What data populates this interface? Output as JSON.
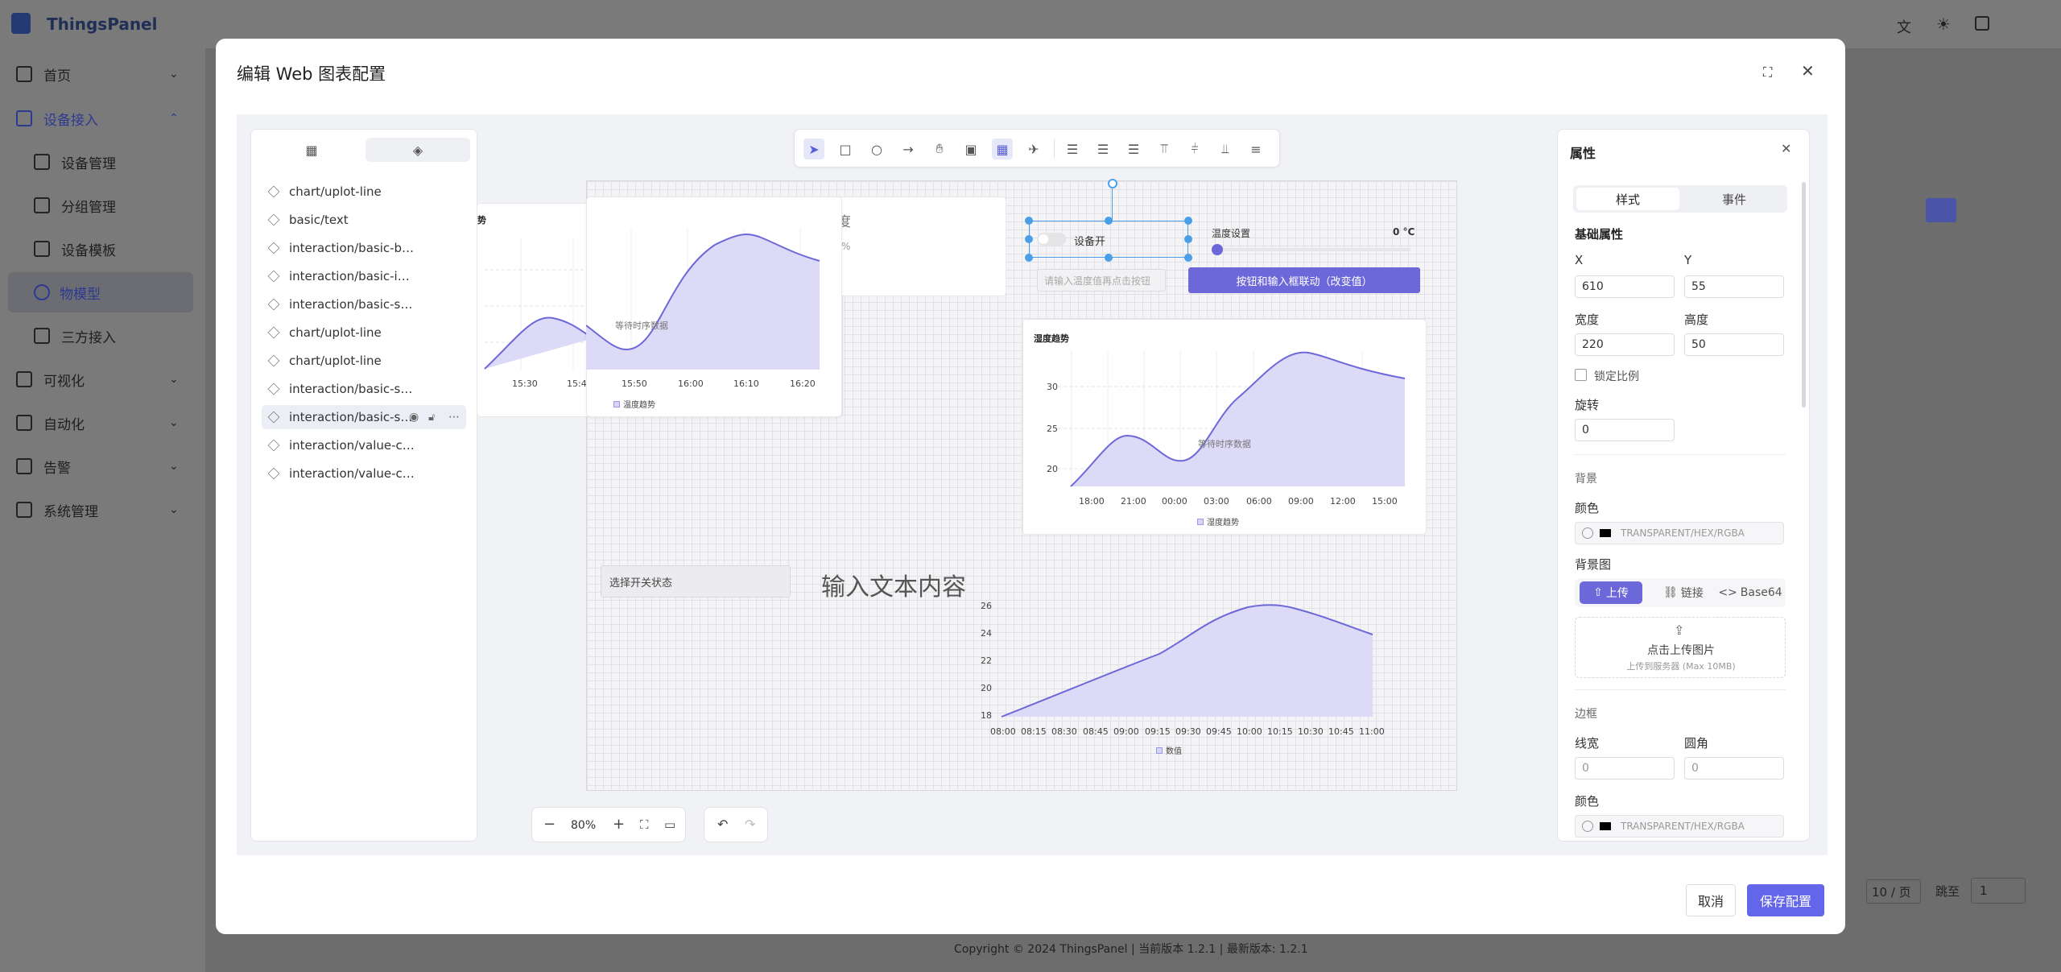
{
  "app": {
    "name": "ThingsPanel",
    "breadcrumb": "物模型",
    "footer": "Copyright © 2024 ThingsPanel | 当前版本 1.2.1 | 最新版本: 1.2.1",
    "page_size": "10 / 页",
    "goto_label": "跳至",
    "goto_value": "1"
  },
  "nav": {
    "items": [
      {
        "label": "首页",
        "icon": "home-icon"
      },
      {
        "label": "设备接入",
        "icon": "device-icon"
      },
      {
        "label": "设备管理",
        "icon": "monitor-icon"
      },
      {
        "label": "分组管理",
        "icon": "grid-icon"
      },
      {
        "label": "设备模板",
        "icon": "template-icon"
      },
      {
        "label": "物模型",
        "icon": "model-icon"
      },
      {
        "label": "三方接入",
        "icon": "link-icon"
      },
      {
        "label": "可视化",
        "icon": "chart-icon"
      },
      {
        "label": "自动化",
        "icon": "automation-icon"
      },
      {
        "label": "告警",
        "icon": "alert-icon"
      },
      {
        "label": "系统管理",
        "icon": "settings-icon"
      }
    ]
  },
  "modal": {
    "title": "编辑 Web 图表配置",
    "cancel": "取消",
    "save": "保存配置"
  },
  "layers": {
    "items": [
      "chart/uplot-line",
      "basic/text",
      "interaction/basic-b…",
      "interaction/basic-i…",
      "interaction/basic-s…",
      "chart/uplot-line",
      "chart/uplot-line",
      "interaction/basic-s…",
      "interaction/basic-s…",
      "interaction/value-c…",
      "interaction/value-c…"
    ]
  },
  "canvas": {
    "humidity_label": "湿度",
    "humidity_pct": "%",
    "switch_label": "设备开",
    "temp_setting_label": "温度设置",
    "temp_setting_value": "0 °C",
    "input_placeholder": "请输入温度值再点击按钮",
    "action_button": "按钮和输入框联动（改变值）",
    "select_placeholder": "选择开关状态",
    "text_content": "输入文本内容",
    "waiting": "等待时序数据",
    "chart1": {
      "ticks": [
        "15:30",
        "15:40",
        "15:50",
        "16:00",
        "16:10",
        "16:20"
      ],
      "legend": "温度趋势",
      "title": "势"
    },
    "chart2": {
      "title": "湿度趋势",
      "xticks": [
        "18:00",
        "21:00",
        "00:00",
        "03:00",
        "06:00",
        "09:00",
        "12:00",
        "15:00"
      ],
      "yticks": [
        "30",
        "25",
        "20"
      ],
      "legend": "湿度趋势"
    },
    "chart3": {
      "xticks": [
        "08:00",
        "08:15",
        "08:30",
        "08:45",
        "09:00",
        "09:15",
        "09:30",
        "09:45",
        "10:00",
        "10:15",
        "10:30",
        "10:45",
        "11:00"
      ],
      "yticks": [
        "26",
        "24",
        "22",
        "20",
        "18"
      ],
      "legend": "数值"
    },
    "zoom": "80%"
  },
  "props": {
    "title": "属性",
    "tab_style": "样式",
    "tab_event": "事件",
    "basic": "基础属性",
    "x_label": "X",
    "y_label": "Y",
    "x": "610",
    "y": "55",
    "w_label": "宽度",
    "h_label": "高度",
    "w": "220",
    "h": "50",
    "lock": "锁定比例",
    "rot_label": "旋转",
    "rot": "0",
    "bg": "背景",
    "color": "颜色",
    "color_placeholder": "TRANSPARENT/HEX/RGBA",
    "bgimg": "背景图",
    "upload": "上传",
    "link": "链接",
    "base64": "Base64",
    "upload_title": "点击上传图片",
    "upload_hint": "上传到服务器 (Max 10MB)",
    "border": "边框",
    "line_w": "线宽",
    "radius": "圆角",
    "line_w_val": "0",
    "radius_val": "0",
    "border_color": "颜色"
  }
}
